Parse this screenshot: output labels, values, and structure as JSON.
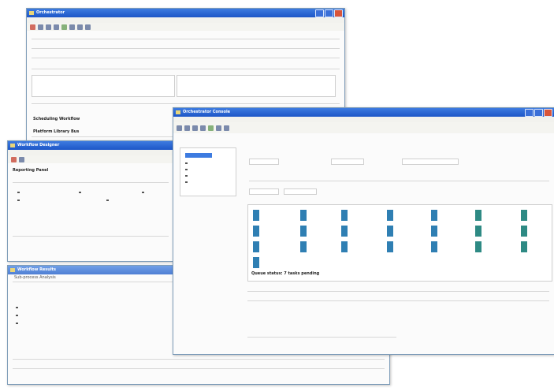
{
  "win1": {
    "title": "Orchestrator"
  },
  "win2": {
    "title": "Workflow Designer"
  },
  "win3": {
    "title": "Orchestrator Console"
  },
  "win4": {
    "title": "Workflow Results"
  },
  "labels": {
    "section1": "Scheduling Workflow",
    "section2": "Platform Library Bus",
    "section3": "Reporting Panel",
    "section4": "Sub-process Analysis",
    "summary": "Queue status: 7 tasks pending"
  },
  "colors": {
    "accent": "#1d56c7",
    "tile_blue": "#2f7fb3",
    "tile_teal": "#2e8a84"
  }
}
